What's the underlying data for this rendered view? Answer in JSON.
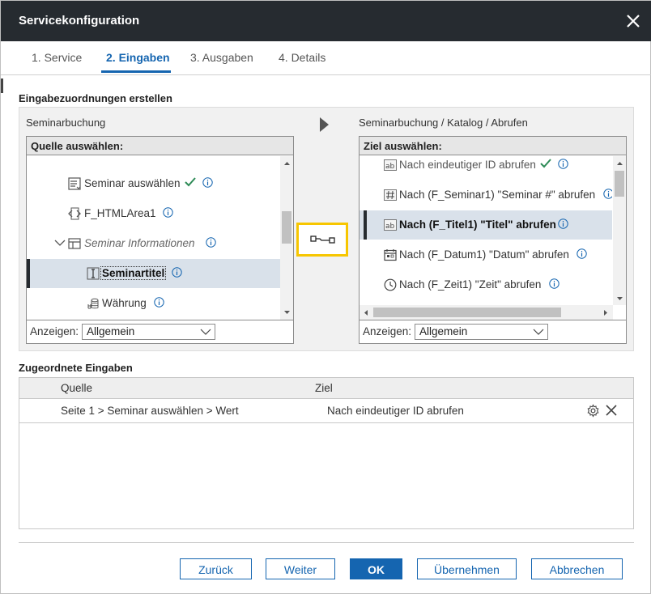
{
  "dialog": {
    "title": "Servicekonfiguration",
    "close_icon": "close-icon"
  },
  "tabs": [
    {
      "label": "1. Service",
      "active": false
    },
    {
      "label": "2. Eingaben",
      "active": true
    },
    {
      "label": "3. Ausgaben",
      "active": false
    },
    {
      "label": "4. Details",
      "active": false
    }
  ],
  "mapping": {
    "section_title": "Eingabezuordnungen erstellen",
    "source": {
      "caption": "Seminarbuchung",
      "header": "Quelle auswählen:",
      "items": [
        {
          "label": "Seminar auswählen",
          "icon": "list-select-icon",
          "checked": true,
          "info": true
        },
        {
          "label": "F_HTMLArea1",
          "icon": "html-code-icon",
          "checked": false,
          "info": true
        },
        {
          "label": "Seminar Informationen",
          "icon": "table-icon",
          "expanded": true,
          "italic": true,
          "info": true
        },
        {
          "label": "Seminartitel",
          "icon": "text-cursor-icon",
          "selected": true,
          "info": true
        },
        {
          "label": "Währung",
          "icon": "coins-icon",
          "info": true
        }
      ],
      "show_label": "Anzeigen:",
      "show_value": "Allgemein"
    },
    "target": {
      "caption": "Seminarbuchung / Katalog / Abrufen",
      "header": "Ziel auswählen:",
      "items": [
        {
          "label": "Nach eindeutiger ID abrufen",
          "icon": "text-field-icon",
          "checked": true,
          "info": true,
          "muted": true
        },
        {
          "label": "Nach (F_Seminar1) \"Seminar #\" abrufen",
          "icon": "number-field-icon",
          "info": true
        },
        {
          "label": "Nach (F_Titel1) \"Titel\" abrufen",
          "icon": "text-field-icon",
          "selected": true,
          "info": true
        },
        {
          "label": "Nach (F_Datum1) \"Datum\" abrufen",
          "icon": "calendar-icon",
          "info": true
        },
        {
          "label": "Nach (F_Zeit1) \"Zeit\" abrufen",
          "icon": "clock-icon",
          "info": true
        }
      ],
      "show_label": "Anzeigen:",
      "show_value": "Allgemein"
    }
  },
  "assigned": {
    "section_title": "Zugeordnete Eingaben",
    "columns": [
      "Quelle",
      "Ziel"
    ],
    "rows": [
      {
        "source": "Seite 1 > Seminar auswählen > Wert",
        "target": "Nach eindeutiger ID abrufen"
      }
    ]
  },
  "buttons": {
    "back": "Zurück",
    "next": "Weiter",
    "ok": "OK",
    "apply": "Übernehmen",
    "cancel": "Abbrechen"
  },
  "colors": {
    "titlebar": "#262b30",
    "accent": "#1565b0",
    "highlight": "#f7c600",
    "check": "#2e8b57"
  }
}
